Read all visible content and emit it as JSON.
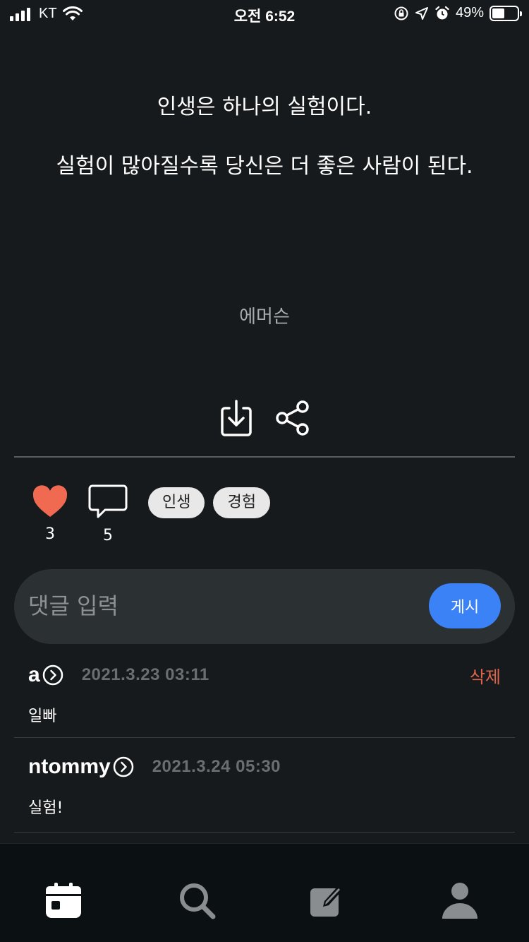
{
  "status_bar": {
    "carrier": "KT",
    "time": "오전 6:52",
    "battery": "49%",
    "battery_level": 0.49
  },
  "quote": {
    "line1": "인생은 하나의 실험이다.",
    "line2": "실험이 많아질수록 당신은 더 좋은 사람이 된다.",
    "author": "에머슨"
  },
  "actions": {
    "download_icon": "download-icon",
    "share_icon": "share-icon"
  },
  "reactions": {
    "likes": "3",
    "comments": "5",
    "heart_color": "#f06a52"
  },
  "tags": [
    "인생",
    "경험"
  ],
  "comment_input": {
    "placeholder": "댓글 입력",
    "post_label": "게시",
    "post_color": "#3b82f6"
  },
  "comments": [
    {
      "user": "a",
      "date": "2021.3.23  03:11",
      "text": "일빠",
      "delete_label": "삭제"
    },
    {
      "user": "ntommy",
      "date": "2021.3.24  05:30",
      "text": "실험!"
    }
  ],
  "tab_bar": {
    "tabs": [
      "calendar-icon",
      "search-icon",
      "edit-icon",
      "profile-icon"
    ]
  }
}
